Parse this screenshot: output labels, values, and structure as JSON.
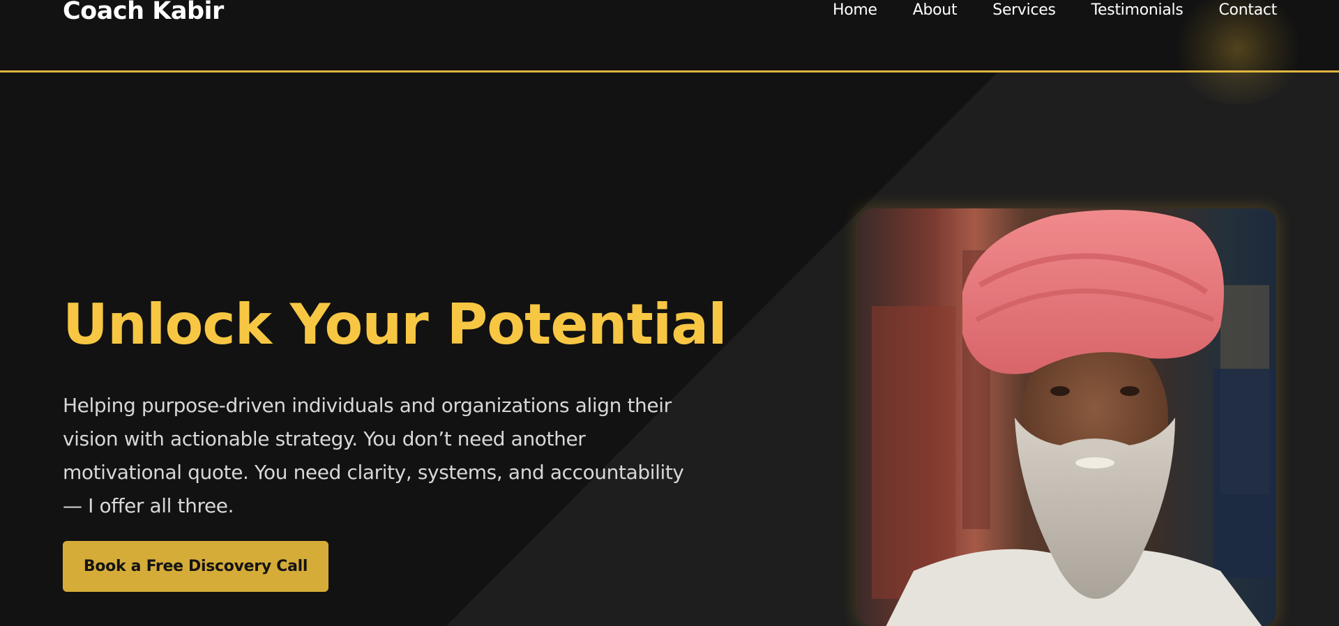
{
  "brand": {
    "name": "Coach Kabir"
  },
  "nav": {
    "items": [
      {
        "label": "Home"
      },
      {
        "label": "About"
      },
      {
        "label": "Services"
      },
      {
        "label": "Testimonials"
      },
      {
        "label": "Contact"
      }
    ]
  },
  "hero": {
    "title": "Unlock Your Potential",
    "description": "Helping purpose-driven individuals and organizations align their vision with actionable strategy. You don’t need another motivational quote. You need clarity, systems, and accountability — I offer all three.",
    "cta_label": "Book a Free Discovery Call"
  },
  "colors": {
    "background": "#121212",
    "panel": "#1e1e1e",
    "accent": "#f7c744",
    "button": "#d6ac38",
    "header_border": "#e0b640"
  }
}
